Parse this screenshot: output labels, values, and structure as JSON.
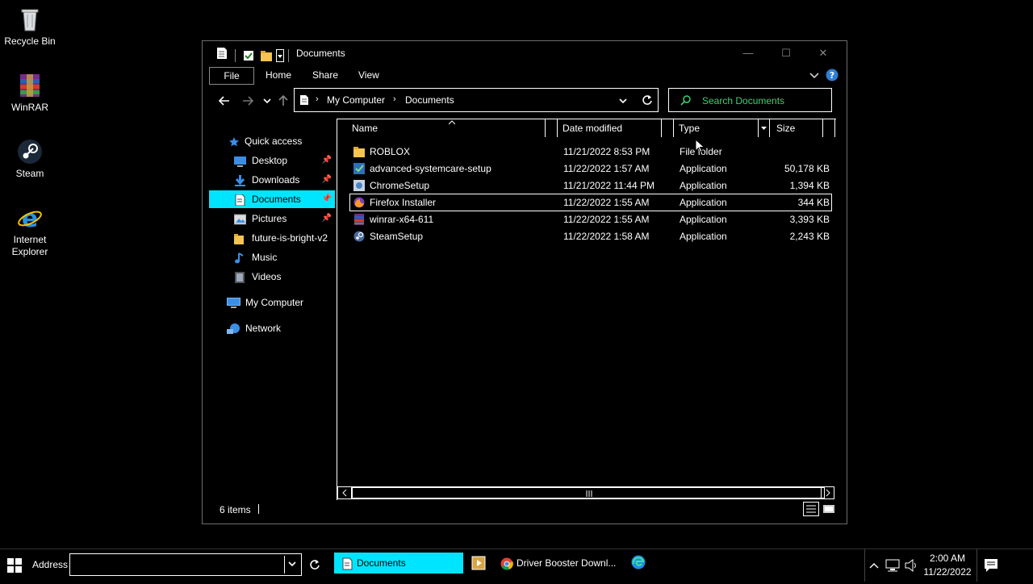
{
  "desktop": {
    "icons": [
      {
        "label": "Recycle Bin"
      },
      {
        "label": "WinRAR"
      },
      {
        "label": "Steam"
      },
      {
        "label": "Internet Explorer"
      }
    ]
  },
  "window": {
    "title": "Documents",
    "controls": {
      "minimize": "—",
      "maximize": "☐",
      "close": "✕"
    },
    "ribbon_tabs": [
      "File",
      "Home",
      "Share",
      "View"
    ],
    "address": {
      "segments": [
        "My Computer",
        "Documents"
      ]
    },
    "search": {
      "placeholder": "Search Documents"
    },
    "nav_pane": {
      "quick_access": "Quick access",
      "items": [
        {
          "label": "Desktop",
          "pinned": true
        },
        {
          "label": "Downloads",
          "pinned": true
        },
        {
          "label": "Documents",
          "pinned": true
        },
        {
          "label": "Pictures",
          "pinned": true
        },
        {
          "label": "future-is-bright-v2",
          "pinned": false
        },
        {
          "label": "Music",
          "pinned": false
        },
        {
          "label": "Videos",
          "pinned": false
        }
      ],
      "my_computer": "My Computer",
      "network": "Network"
    },
    "columns": {
      "name": "Name",
      "date": "Date modified",
      "type": "Type",
      "size": "Size"
    },
    "files": [
      {
        "name": "ROBLOX",
        "date": "11/21/2022 8:53 PM",
        "type": "File folder",
        "size": "",
        "icon": "folder-icon"
      },
      {
        "name": "advanced-systemcare-setup",
        "date": "11/22/2022 1:57 AM",
        "type": "Application",
        "size": "50,178 KB",
        "icon": "installer-icon"
      },
      {
        "name": "ChromeSetup",
        "date": "11/21/2022 11:44 PM",
        "type": "Application",
        "size": "1,394 KB",
        "icon": "installer-icon"
      },
      {
        "name": "Firefox Installer",
        "date": "11/22/2022 1:55 AM",
        "type": "Application",
        "size": "344 KB",
        "icon": "firefox-icon"
      },
      {
        "name": "winrar-x64-611",
        "date": "11/22/2022 1:55 AM",
        "type": "Application",
        "size": "3,393 KB",
        "icon": "winrar-icon"
      },
      {
        "name": "SteamSetup",
        "date": "11/22/2022 1:58 AM",
        "type": "Application",
        "size": "2,243 KB",
        "icon": "steam-icon"
      }
    ],
    "status": {
      "count": "6 items"
    }
  },
  "taskbar": {
    "address_label": "Address",
    "tasks": [
      {
        "label": "Documents"
      },
      {
        "label": "Driver Booster Downl..."
      }
    ],
    "clock": {
      "time": "2:00 AM",
      "date": "11/22/2022"
    }
  },
  "colors": {
    "accent_cyan": "#00e5ff",
    "search_green": "#3cd070",
    "help_blue": "#2d7fd6"
  }
}
